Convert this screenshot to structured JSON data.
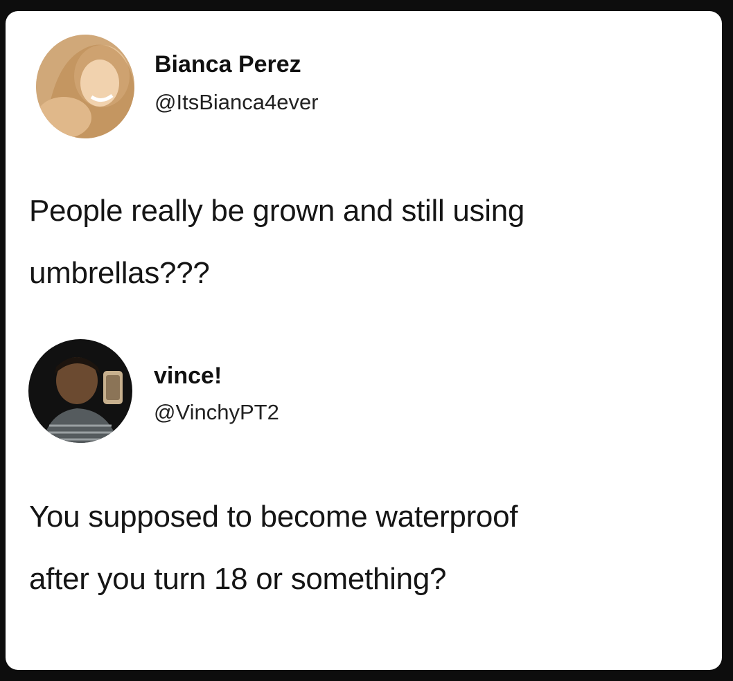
{
  "tweets": [
    {
      "author_name": "Bianca Perez",
      "author_handle": "@ItsBianca4ever",
      "avatar_icon": "user-avatar-photo",
      "text_lines": [
        "People really be grown and still using",
        "umbrellas???"
      ]
    },
    {
      "author_name": "vince!",
      "author_handle": "@VinchyPT2",
      "avatar_icon": "user-avatar-photo",
      "text_lines": [
        "You supposed to become waterproof",
        "after you turn 18 or something?"
      ]
    }
  ],
  "colors": {
    "background": "#0d0d0d",
    "card": "#ffffff",
    "text": "#151515"
  }
}
